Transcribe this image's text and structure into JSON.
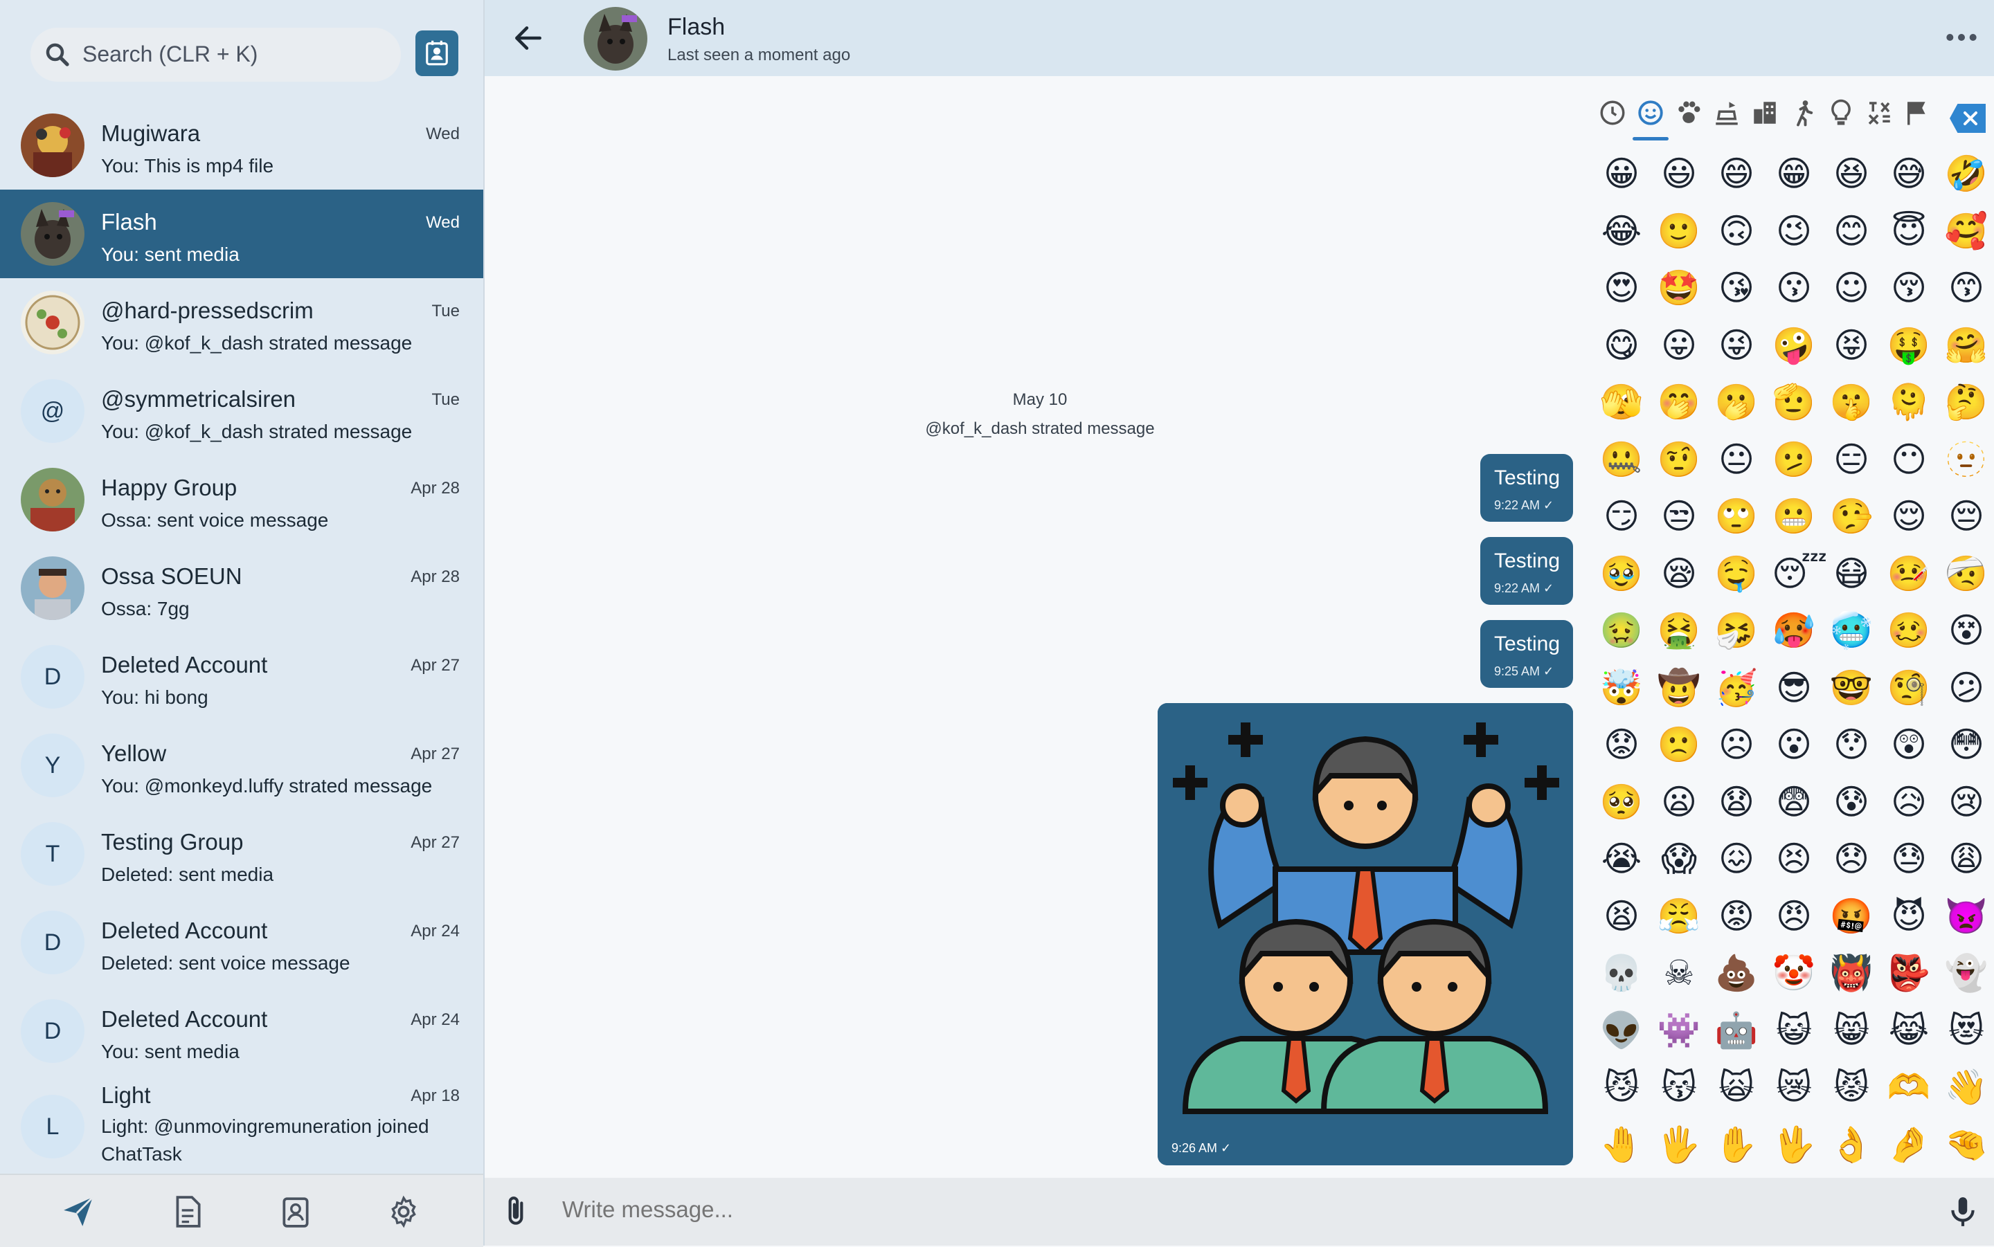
{
  "search": {
    "placeholder": "Search (CLR + K)"
  },
  "chats": [
    {
      "name": "Mugiwara",
      "preview": "You: This is mp4 file",
      "date": "Wed"
    },
    {
      "name": "Flash",
      "preview": "You: sent media",
      "date": "Wed"
    },
    {
      "name": "@hard-pressedscrim",
      "preview": "You: @kof_k_dash strated message",
      "date": "Tue"
    },
    {
      "name": "@symmetricalsiren",
      "preview": "You: @kof_k_dash strated message",
      "date": "Tue",
      "initial": "@"
    },
    {
      "name": "Happy Group",
      "preview": "Ossa: sent voice message",
      "date": "Apr 28"
    },
    {
      "name": "Ossa SOEUN",
      "preview": "Ossa: 7gg",
      "date": "Apr 28"
    },
    {
      "name": "Deleted Account",
      "preview": "You: hi bong",
      "date": "Apr 27",
      "initial": "D"
    },
    {
      "name": "Yellow",
      "preview": "You: @monkeyd.luffy strated message",
      "date": "Apr 27",
      "initial": "Y"
    },
    {
      "name": "Testing Group",
      "preview": "Deleted: sent media",
      "date": "Apr 27",
      "initial": "T"
    },
    {
      "name": "Deleted Account",
      "preview": "Deleted: sent voice message",
      "date": "Apr 24",
      "initial": "D"
    },
    {
      "name": "Deleted Account",
      "preview": "You: sent media",
      "date": "Apr 24",
      "initial": "D"
    },
    {
      "name": "Light",
      "preview": "Light: @unmovingremuneration joined ChatTask",
      "date": "Apr 18",
      "initial": "L"
    }
  ],
  "header": {
    "name": "Flash",
    "status": "Last seen a moment ago"
  },
  "conversation": {
    "day": "May 10",
    "system_message": "@kof_k_dash strated message",
    "messages": [
      {
        "text": "Testing",
        "time": "9:22 AM ✓"
      },
      {
        "text": "Testing",
        "time": "9:22 AM ✓"
      },
      {
        "text": "Testing",
        "time": "9:25 AM ✓"
      }
    ],
    "image_message": {
      "time": "9:26 AM ✓"
    }
  },
  "emoji_tabs": [
    "recent-icon",
    "smileys-icon",
    "animals-icon",
    "food-icon",
    "travel-icon",
    "activity-icon",
    "objects-icon",
    "symbols-icon",
    "flags-icon"
  ],
  "emoji_rows": [
    [
      "😀",
      "😃",
      "😄",
      "😁",
      "😆",
      "😅",
      "🤣"
    ],
    [
      "😂",
      "🙂",
      "🙃",
      "😉",
      "😊",
      "😇",
      "🥰"
    ],
    [
      "😍",
      "🤩",
      "😘",
      "😗",
      "☺",
      "😚",
      "😙"
    ],
    [
      "😋",
      "😛",
      "😜",
      "🤪",
      "😝",
      "🤑",
      "🤗"
    ],
    [
      "🫣",
      "🤭",
      "🫢",
      "🫡",
      "🤫",
      "🫠",
      "🤔"
    ],
    [
      "🤐",
      "🤨",
      "😐",
      "🫤",
      "😑",
      "😶",
      "🫥"
    ],
    [
      "😏",
      "😒",
      "🙄",
      "😬",
      "🤥",
      "😌",
      "😔"
    ],
    [
      "🥹",
      "😪",
      "🤤",
      "😴",
      "😷",
      "🤒",
      "🤕"
    ],
    [
      "🤢",
      "🤮",
      "🤧",
      "🥵",
      "🥶",
      "🥴",
      "😵"
    ],
    [
      "🤯",
      "🤠",
      "🥳",
      "😎",
      "🤓",
      "🧐",
      "😕"
    ],
    [
      "😟",
      "🙁",
      "☹",
      "😮",
      "😯",
      "😲",
      "😳"
    ],
    [
      "🥺",
      "😦",
      "😧",
      "😨",
      "😰",
      "😥",
      "😢"
    ],
    [
      "😭",
      "😱",
      "😖",
      "😣",
      "😞",
      "😓",
      "😩"
    ],
    [
      "😫",
      "😤",
      "😡",
      "😠",
      "🤬",
      "😈",
      "👿"
    ],
    [
      "💀",
      "☠",
      "💩",
      "🤡",
      "👹",
      "👺",
      "👻"
    ],
    [
      "👽",
      "👾",
      "🤖",
      "😺",
      "😸",
      "😹",
      "😻"
    ],
    [
      "😼",
      "😽",
      "🙀",
      "😿",
      "😾",
      "🫶",
      "👋"
    ],
    [
      "🤚",
      "🖐",
      "✋",
      "🖖",
      "👌",
      "🤌",
      "🤏"
    ]
  ],
  "composer": {
    "placeholder": "Write message..."
  },
  "colors": {
    "accent": "#2b6286",
    "sidebar": "#dfe9f2",
    "header": "#d9e6f0",
    "tab_active": "#2f7cc4"
  }
}
